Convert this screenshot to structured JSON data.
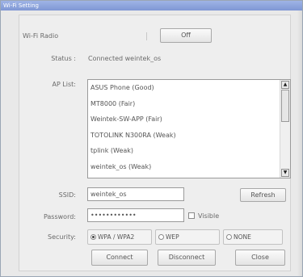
{
  "window": {
    "title": "Wi-Fi Setting"
  },
  "wifi_radio": {
    "label": "Wi-Fi Radio",
    "button": "Off"
  },
  "status": {
    "label": "Status :",
    "value": "Connected weintek_os"
  },
  "ap_list": {
    "label": "AP List:",
    "items": [
      "ASUS Phone (Good)",
      "MT8000 (Fair)",
      "Weintek-SW-APP (Fair)",
      "TOTOLINK N300RA (Weak)",
      "tplink (Weak)",
      "weintek_os (Weak)"
    ],
    "scroll_up": "▲",
    "scroll_down": "▼"
  },
  "ssid": {
    "label": "SSID:",
    "value": "weintek_os",
    "refresh_button": "Refresh"
  },
  "password": {
    "label": "Password:",
    "value": "••••••••••••",
    "visible_label": "Visible"
  },
  "security": {
    "label": "Security:",
    "options": [
      {
        "label": "WPA / WPA2",
        "selected": true
      },
      {
        "label": "WEP",
        "selected": false
      },
      {
        "label": "NONE",
        "selected": false
      }
    ]
  },
  "actions": {
    "connect": "Connect",
    "disconnect": "Disconnect",
    "close": "Close"
  }
}
